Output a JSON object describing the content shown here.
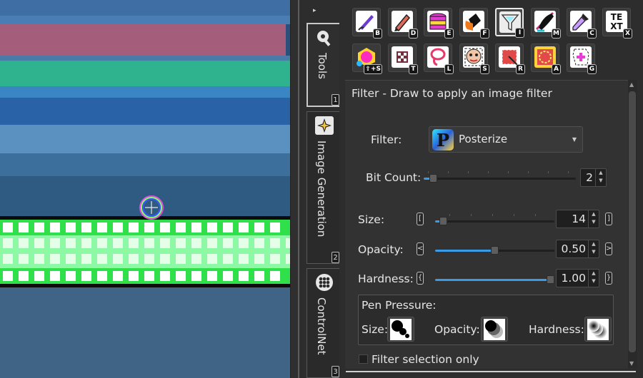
{
  "dock": {
    "collapse_glyph": "▸",
    "tabs": [
      {
        "label": "Tools",
        "number": "1",
        "icon": "wrench-gear-icon"
      },
      {
        "label": "Image Generation",
        "number": "2",
        "icon": "sparkle-icon"
      },
      {
        "label": "ControlNet",
        "number": "3",
        "icon": "network-icon"
      }
    ]
  },
  "tools": [
    {
      "key": "B",
      "icon": "brush-icon"
    },
    {
      "key": "D",
      "icon": "pencil-icon"
    },
    {
      "key": "E",
      "icon": "eraser-layers-icon"
    },
    {
      "key": "F",
      "icon": "fill-bucket-icon"
    },
    {
      "key": "I",
      "icon": "filter-funnel-icon",
      "selected": true
    },
    {
      "key": "M",
      "icon": "smudge-icon"
    },
    {
      "key": "C",
      "icon": "eyedropper-icon"
    },
    {
      "key": "X",
      "icon": "text-icon",
      "glyph": "TE\nXT"
    },
    {
      "key": "⇧+S",
      "icon": "shape-selection-icon"
    },
    {
      "key": "T",
      "icon": "transform-icon"
    },
    {
      "key": "L",
      "icon": "lasso-icon"
    },
    {
      "key": "S",
      "icon": "smart-selection-icon"
    },
    {
      "key": "R",
      "icon": "rectangle-selection-icon"
    },
    {
      "key": "A",
      "icon": "ellipse-selection-icon"
    },
    {
      "key": "G",
      "icon": "selection-fill-icon"
    }
  ],
  "panel": {
    "title": "Filter - Draw to apply an image filter",
    "filter_label": "Filter:",
    "filter_value": "Posterize",
    "bit_count_label": "Bit Count:",
    "bit_count_value": "2",
    "bit_count_fraction": 0.04,
    "size_label": "Size:",
    "size_value": "14",
    "size_fraction": 0.04,
    "opacity_label": "Opacity:",
    "opacity_value": "0.50",
    "opacity_fraction": 0.5,
    "hardness_label": "Hardness:",
    "hardness_value": "1.00",
    "hardness_fraction": 1.0,
    "pen_pressure": {
      "title": "Pen Pressure:",
      "size": "Size:",
      "opacity": "Opacity:",
      "hardness": "Hardness:"
    },
    "filter_selection_only": "Filter selection only"
  },
  "colors": {
    "accent": "#3b9be4",
    "glow_green": "#6dff8f"
  }
}
